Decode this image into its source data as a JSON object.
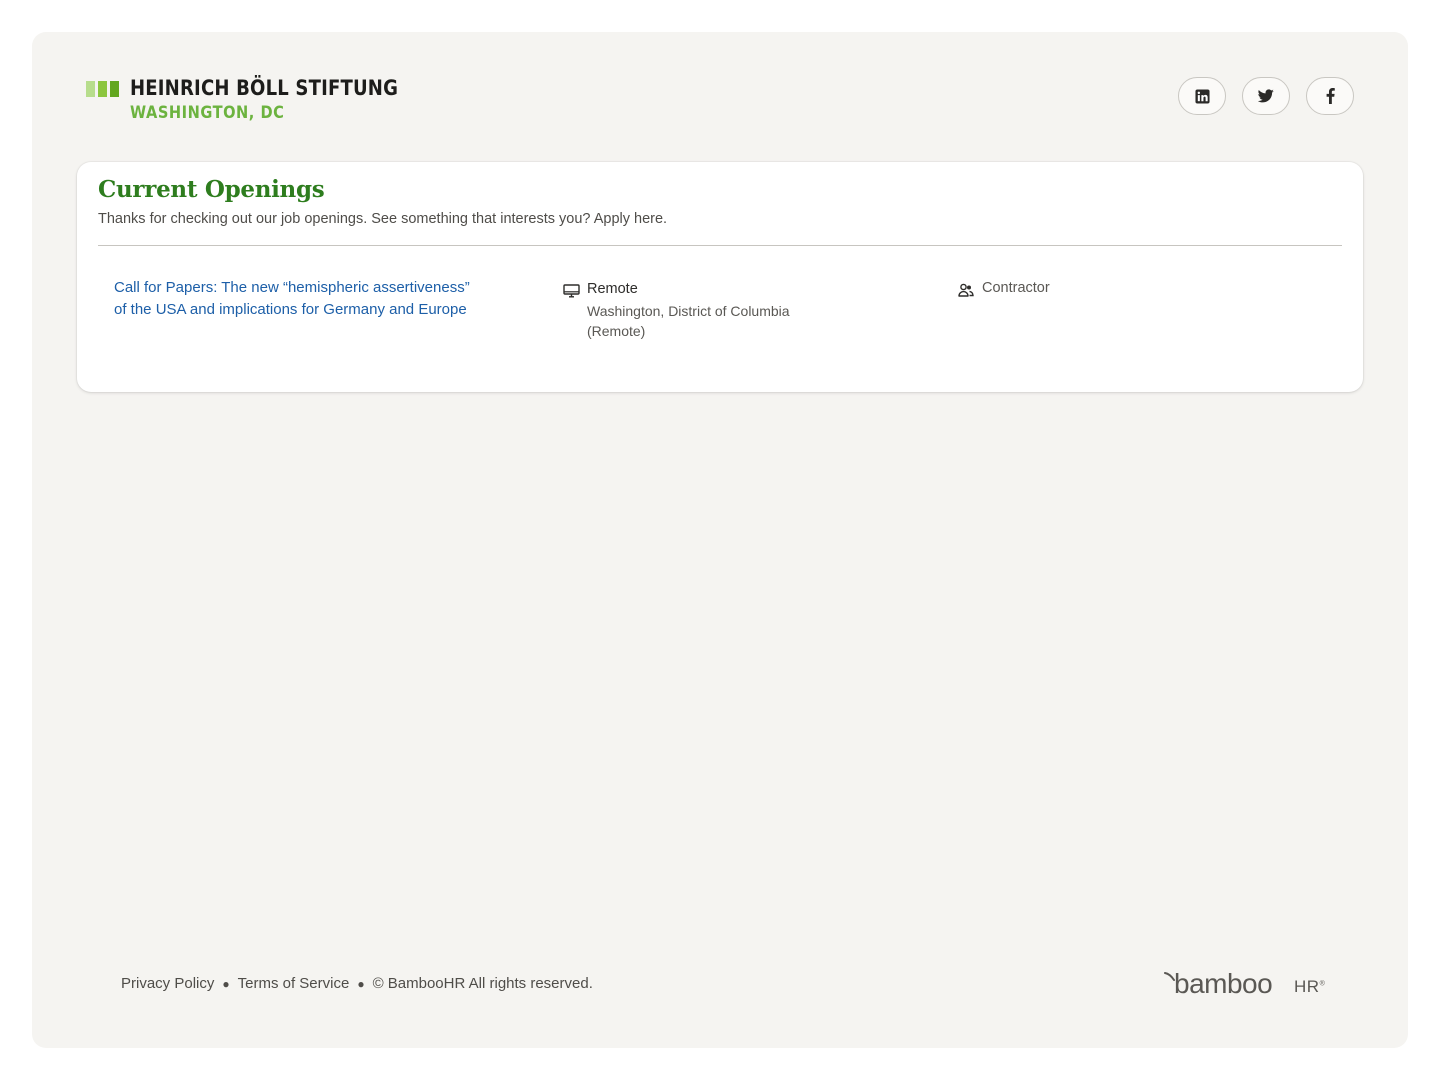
{
  "header": {
    "logo_name": "HEINRICH BÖLL STIFTUNG",
    "logo_sub": "WASHINGTON, DC",
    "logo_bar_colors": [
      "#b7dd8c",
      "#8cc63f",
      "#62a61f"
    ],
    "socials": [
      {
        "icon": "linkedin-icon"
      },
      {
        "icon": "twitter-icon"
      },
      {
        "icon": "facebook-icon"
      }
    ]
  },
  "openings": {
    "title": "Current Openings",
    "subtitle": "Thanks for checking out our job openings. See something that interests you? Apply here.",
    "jobs": [
      {
        "title": "Call for Papers: The new “hemispheric assertiveness” of the USA and implications for Germany and Europe",
        "location_type": "Remote",
        "location_icon": "monitor-icon",
        "location_detail": "Washington, District of Columbia (Remote)",
        "employment_icon": "user-group-icon",
        "employment_type": "Contractor"
      }
    ]
  },
  "footer": {
    "privacy": "Privacy Policy",
    "terms": "Terms of Service",
    "copyright": "© BambooHR All rights reserved.",
    "brand_main": "bamboo",
    "brand_hr": "HR",
    "brand_trademark": "®"
  },
  "colors": {
    "heading_green": "#2e7d1e",
    "link_blue": "#1d5fa8",
    "logo_green": "#6cb33f",
    "page_bg": "#f5f4f1"
  }
}
